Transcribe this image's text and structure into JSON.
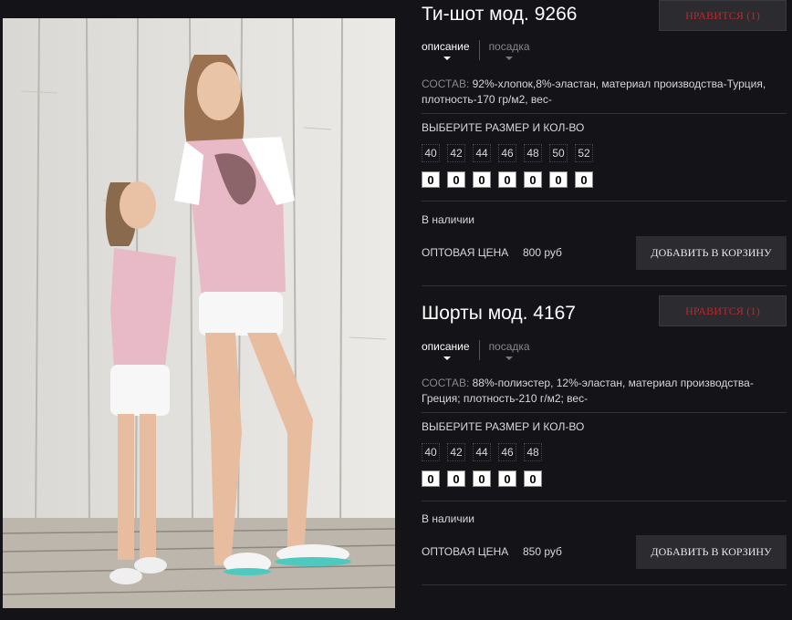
{
  "products": [
    {
      "title": "Ти-шот мод. 9266",
      "like_label": "НРАВИТСЯ (1)",
      "tabs": [
        "описание",
        "посадка"
      ],
      "composition_label": "СОСТАВ:",
      "composition_text": " 92%-хлопок,8%-эластан, материал производства-Турция, плотность-170 гр/м2, вес-",
      "size_heading": "ВЫБЕРИТЕ РАЗМЕР И КОЛ-ВО",
      "sizes": [
        "40",
        "42",
        "44",
        "46",
        "48",
        "50",
        "52"
      ],
      "quantities": [
        "0",
        "0",
        "0",
        "0",
        "0",
        "0",
        "0"
      ],
      "stock": "В наличии",
      "price_label": "ОПТОВАЯ ЦЕНА",
      "price_value": "800 руб",
      "cart_label": "ДОБАВИТЬ В КОРЗИНУ"
    },
    {
      "title": "Шорты мод. 4167",
      "like_label": "НРАВИТСЯ (1)",
      "tabs": [
        "описание",
        "посадка"
      ],
      "composition_label": "СОСТАВ:",
      "composition_text": " 88%-полиэстер, 12%-эластан, материал производства-Греция; плотность-210 г/м2; вес-",
      "size_heading": "ВЫБЕРИТЕ РАЗМЕР И КОЛ-ВО",
      "sizes": [
        "40",
        "42",
        "44",
        "46",
        "48"
      ],
      "quantities": [
        "0",
        "0",
        "0",
        "0",
        "0"
      ],
      "stock": "В наличии",
      "price_label": "ОПТОВАЯ ЦЕНА",
      "price_value": "850 руб",
      "cart_label": "ДОБАВИТЬ В КОРЗИНУ"
    }
  ],
  "colors": {
    "background": "#141317",
    "like_text": "#c0262c",
    "button_bg": "#2c2b2f",
    "tshirt_pink": "#e8b9c6"
  }
}
